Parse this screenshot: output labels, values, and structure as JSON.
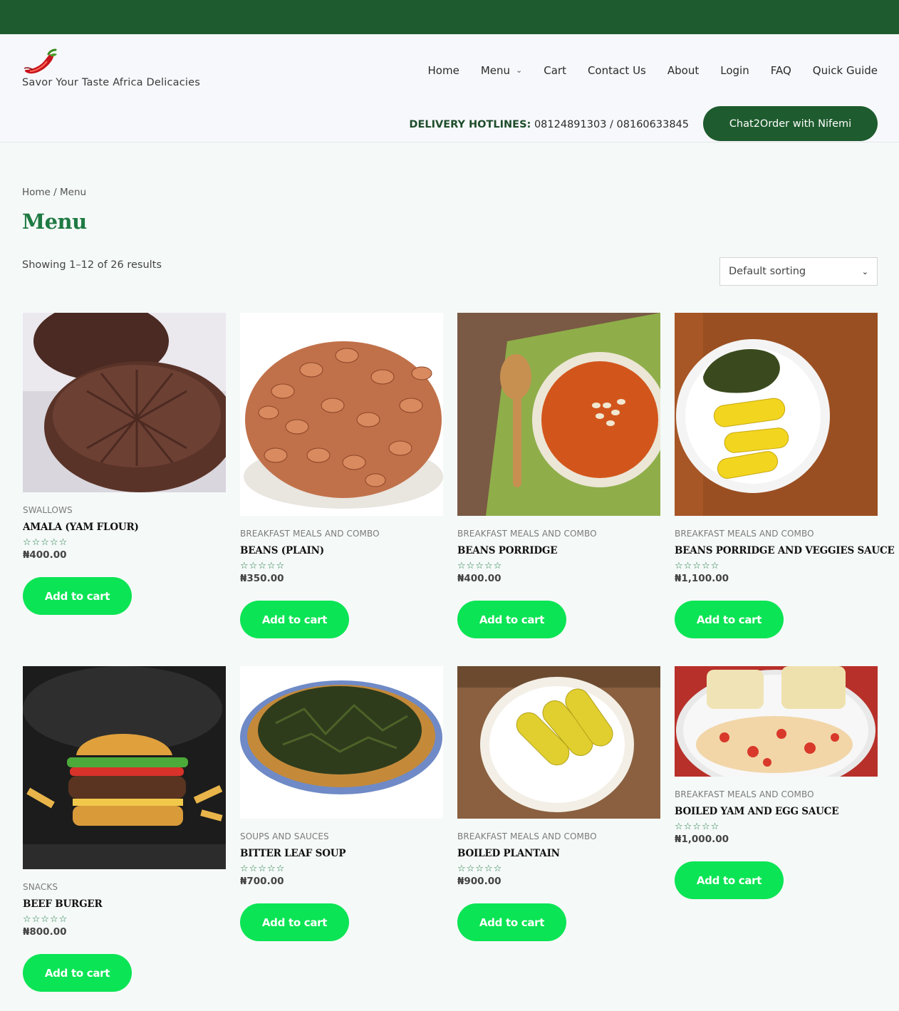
{
  "site": {
    "tagline": "Savor Your Taste Africa Delicacies"
  },
  "nav": {
    "items": [
      "Home",
      "Menu",
      "Cart",
      "Contact Us",
      "About",
      "Login",
      "FAQ",
      "Quick Guide"
    ]
  },
  "hotline": {
    "label": "DELIVERY HOTLINES:",
    "numbers": "08124891303 / 08160633845"
  },
  "chat_button": "Chat2Order with Nifemi",
  "breadcrumb": {
    "home": "Home",
    "separator": "/",
    "current": "Menu"
  },
  "page_title": "Menu",
  "result_count": "Showing 1–12 of 26 results",
  "sorting": {
    "selected": "Default sorting"
  },
  "products": [
    {
      "category": "SWALLOWS",
      "name": "AMALA (YAM FLOUR)",
      "rating": 0,
      "price": "₦400.00",
      "button": "Add to cart",
      "image_icon": "amala-image"
    },
    {
      "category": "BREAKFAST MEALS AND COMBO",
      "name": "BEANS (PLAIN)",
      "rating": 0,
      "price": "₦350.00",
      "button": "Add to cart",
      "image_icon": "beans-image"
    },
    {
      "category": "BREAKFAST MEALS AND COMBO",
      "name": "BEANS PORRIDGE",
      "rating": 0,
      "price": "₦400.00",
      "button": "Add to cart",
      "image_icon": "porridge-image"
    },
    {
      "category": "BREAKFAST MEALS AND COMBO",
      "name": "BEANS PORRIDGE AND VEGGIES SAUCE",
      "rating": 0,
      "price": "₦1,100.00",
      "button": "Add to cart",
      "image_icon": "plantain-veggies-image"
    },
    {
      "category": "SNACKS",
      "name": "BEEF BURGER",
      "rating": 0,
      "price": "₦800.00",
      "button": "Add to cart",
      "image_icon": "burger-image"
    },
    {
      "category": "SOUPS AND SAUCES",
      "name": "BITTER LEAF SOUP",
      "rating": 0,
      "price": "₦700.00",
      "button": "Add to cart",
      "image_icon": "soup-image"
    },
    {
      "category": "BREAKFAST MEALS AND COMBO",
      "name": "BOILED PLANTAIN",
      "rating": 0,
      "price": "₦900.00",
      "button": "Add to cart",
      "image_icon": "plantain-image"
    },
    {
      "category": "BREAKFAST MEALS AND COMBO",
      "name": "BOILED YAM AND EGG SAUCE",
      "rating": 0,
      "price": "₦1,000.00",
      "button": "Add to cart",
      "image_icon": "yam-egg-image"
    }
  ],
  "colors": {
    "brand_dark_green": "#1e5b2e",
    "title_green": "#1e7a43",
    "button_green": "#0be454",
    "star_green": "#1e7a43"
  },
  "icons": {
    "logo": "chili-pepper-logo",
    "nav_dropdown": "chevron-down-icon",
    "select_dropdown": "chevron-down-icon",
    "rating": "star-outline-icon"
  }
}
